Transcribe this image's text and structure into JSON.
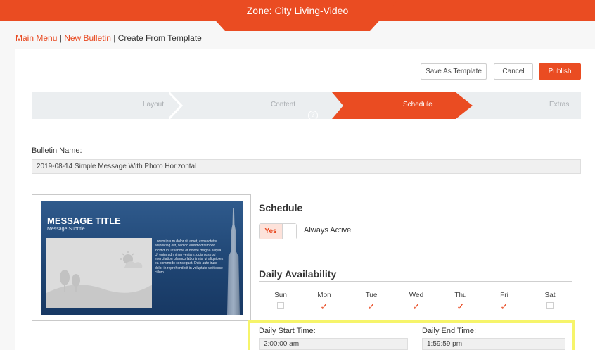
{
  "header": {
    "zone_title": "Zone: City Living-Video"
  },
  "breadcrumb": {
    "main_menu": "Main Menu",
    "new_bulletin": "New Bulletin",
    "current": "Create From Template",
    "separator": "|"
  },
  "actions": {
    "save_template": "Save As Template",
    "cancel": "Cancel",
    "publish": "Publish"
  },
  "steps": {
    "layout": "Layout",
    "content": "Content",
    "schedule": "Schedule",
    "extras": "Extras",
    "help": "?"
  },
  "bulletin": {
    "name_label": "Bulletin Name:",
    "name_value": "2019-08-14 Simple Message With Photo Horizontal"
  },
  "preview": {
    "title": "MESSAGE TITLE",
    "subtitle": "Message Subtitle",
    "body": "Lorem ipsum dolor sit amet, consectetur adipiscing elit, sed do eiusmod tempor incididunt ut labore et dolore magna aliqua. Ut enim ad minim veniam, quis nostrud exercitation ullamco laboris nisi ut aliquip ex ea commodo consequat. Duis aute irure dolor in reprehenderit in voluptate velit esse cillum."
  },
  "schedule": {
    "title": "Schedule",
    "toggle_label": "Yes",
    "always_active": "Always Active"
  },
  "daily": {
    "title": "Daily Availability",
    "days": [
      {
        "label": "Sun",
        "checked": false
      },
      {
        "label": "Mon",
        "checked": true
      },
      {
        "label": "Tue",
        "checked": true
      },
      {
        "label": "Wed",
        "checked": true
      },
      {
        "label": "Thu",
        "checked": true
      },
      {
        "label": "Fri",
        "checked": true
      },
      {
        "label": "Sat",
        "checked": false
      }
    ],
    "check_glyph": "✓"
  },
  "times": {
    "start_label": "Daily Start Time:",
    "start_value": "2:00:00 am",
    "end_label": "Daily End Time:",
    "end_value": "1:59:59 pm"
  },
  "colors": {
    "accent": "#ea4c22",
    "highlight": "#f6f46a"
  }
}
